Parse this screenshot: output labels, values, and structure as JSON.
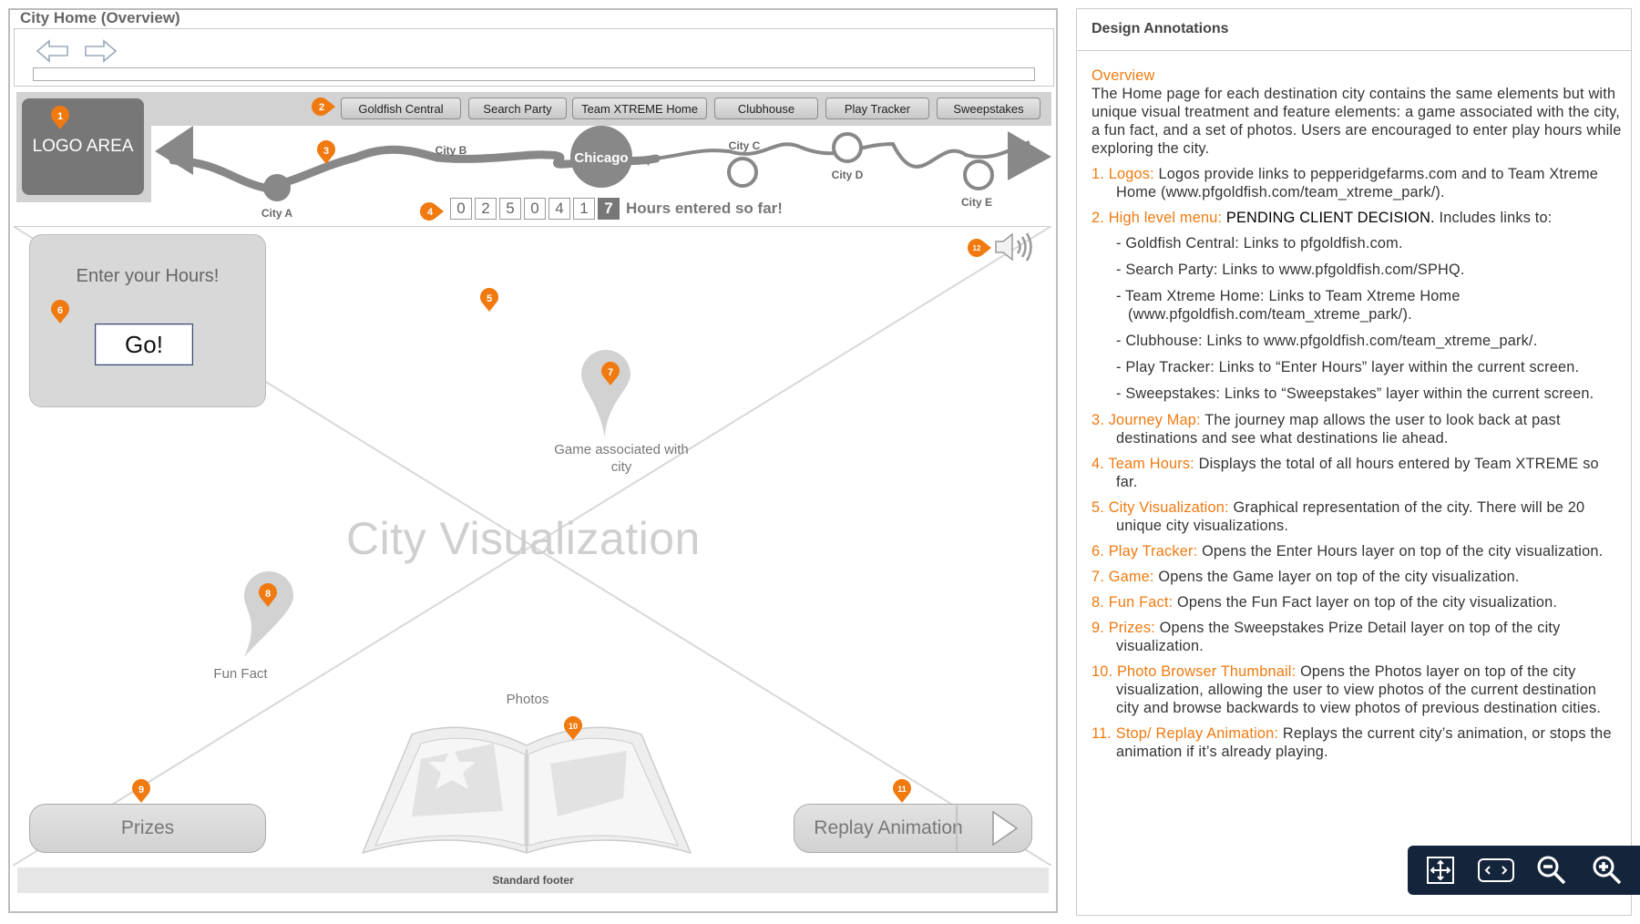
{
  "frame_title": "City Home (Overview)",
  "logo_label": "LOGO AREA",
  "menu": [
    {
      "label": "Goldfish Central"
    },
    {
      "label": "Search Party"
    },
    {
      "label": "Team XTREME Home"
    },
    {
      "label": "Clubhouse"
    },
    {
      "label": "Play Tracker"
    },
    {
      "label": "Sweepstakes"
    }
  ],
  "journey": {
    "cities": [
      "City A",
      "City B",
      "Chicago",
      "City C",
      "City D",
      "City E"
    ]
  },
  "hours": {
    "digits": [
      "0",
      "2",
      "5",
      "0",
      "4",
      "1",
      "7"
    ],
    "label": "Hours entered so far!"
  },
  "visualization_label": "City Visualization",
  "enter_hours": {
    "title": "Enter your Hours!",
    "button": "Go!"
  },
  "game_label": "Game associated with city",
  "fun_fact_label": "Fun Fact",
  "photos_label": "Photos",
  "prizes_button": "Prizes",
  "replay_button": "Replay Animation",
  "footer": "Standard footer",
  "badges": [
    "1",
    "2",
    "3",
    "4",
    "5",
    "6",
    "7",
    "8",
    "9",
    "10",
    "11",
    "12"
  ],
  "accent_color": "#f07a10",
  "annotations": {
    "title": "Design Annotations",
    "overview_heading": "Overview",
    "overview_text": "The Home page for each destination city contains the same elements but with unique visual treatment and feature elements: a game associated with the city, a fun fact, and a set of photos.  Users are encouraged to enter play hours while exploring the city.",
    "items": [
      {
        "num": "1.",
        "title": "Logos:",
        "lead": "",
        "text": "Logos provide links to pepperidgefarms.com and to Team Xtreme Home (www.pfgoldfish.com/team_xtreme_park/)."
      },
      {
        "num": "2.",
        "title": "High level menu:",
        "lead": "PENDING CLIENT DECISION.",
        "text": "Includes links to:"
      }
    ],
    "subitems": [
      "- Goldfish Central:  Links to pfgoldfish.com.",
      "- Search Party:  Links to www.pfgoldfish.com/SPHQ.",
      "- Team Xtreme Home: Links to Team Xtreme Home (www.pfgoldfish.com/team_xtreme_park/).",
      "- Clubhouse:  Links to www.pfgoldfish.com/team_xtreme_park/.",
      "- Play Tracker: Links to “Enter Hours” layer within the current screen.",
      "- Sweepstakes: Links to “Sweepstakes” layer within the current screen."
    ],
    "more_items": [
      {
        "num": "3.",
        "title": "Journey Map:",
        "text": "The journey map allows the user to look back at past destinations and see what destinations lie ahead."
      },
      {
        "num": "4.",
        "title": "Team Hours:",
        "text": "Displays the total of all hours entered by Team XTREME so far."
      },
      {
        "num": "5.",
        "title": "City Visualization:",
        "text": "Graphical representation of the city.  There will be 20 unique city visualizations."
      },
      {
        "num": "6.",
        "title": "Play Tracker:",
        "text": "Opens the Enter Hours layer on top of the city visualization."
      },
      {
        "num": "7.",
        "title": "Game:",
        "text": "Opens the Game layer on top of the city visualization."
      },
      {
        "num": "8.",
        "title": "Fun Fact:",
        "text": "Opens the Fun Fact layer on top of the city visualization."
      },
      {
        "num": "9.",
        "title": "Prizes:",
        "text": "Opens the Sweepstakes Prize Detail layer on top of the city visualization."
      },
      {
        "num": "10.",
        "title": "Photo Browser Thumbnail:",
        "text": "Opens the Photos layer on top of the city visualization, allowing the user to view photos of the current destination city and browse backwards to view photos of previous destination cities."
      },
      {
        "num": "11.",
        "title": "Stop/ Replay Animation:",
        "text": "Replays the current city’s animation, or stops the animation if it’s already playing."
      }
    ]
  },
  "viewer_toolbar": [
    "fit-screen-icon",
    "page-nav-icon",
    "zoom-out-icon",
    "zoom-in-icon"
  ]
}
